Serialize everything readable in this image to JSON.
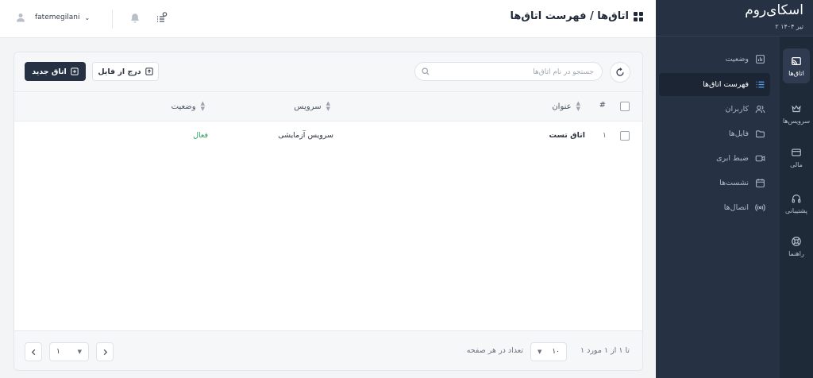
{
  "brand": {
    "name": "اسکای‌روم",
    "date": "۲ تیر ۱۴۰۴"
  },
  "rail": [
    {
      "label": "اتاق‌ها",
      "icon": "cast-icon",
      "active": true
    },
    {
      "label": "سرویس‌ها",
      "icon": "crown-icon"
    },
    {
      "label": "مالی",
      "icon": "credit-card-icon"
    },
    {
      "label": "پشتیبانی",
      "icon": "headphones-icon"
    },
    {
      "label": "راهنما",
      "icon": "lifebuoy-icon"
    }
  ],
  "menu": [
    {
      "label": "وضعیت",
      "icon": "chart-icon"
    },
    {
      "label": "فهرست اتاق‌ها",
      "icon": "list-icon",
      "active": true
    },
    {
      "label": "کاربران",
      "icon": "users-icon"
    },
    {
      "label": "فایل‌ها",
      "icon": "folder-icon"
    },
    {
      "label": "ضبط ابری",
      "icon": "video-icon"
    },
    {
      "label": "نشست‌ها",
      "icon": "calendar-icon"
    },
    {
      "label": "اتصال‌ها",
      "icon": "broadcast-icon"
    }
  ],
  "header": {
    "title": "اتاق‌ها / فهرست اتاق‌ها",
    "user": "fatemegilani"
  },
  "toolbar": {
    "new_room": "اتاق جدید",
    "import_file": "درج از فایل",
    "search_placeholder": "جستجو در نام اتاق‌ها"
  },
  "table": {
    "columns": {
      "index": "#",
      "title": "عنوان",
      "service": "سرویس",
      "status": "وضعیت"
    },
    "rows": [
      {
        "index": "۱",
        "title": "اتاق تست",
        "service": "سرویس آزمایشی",
        "status": "فعال"
      }
    ]
  },
  "footer": {
    "summary": "۱ تا ۱ از ۱ مورد",
    "per_page_label": "تعداد در هر صفحه",
    "per_page": "۱۰",
    "page": "۱"
  },
  "colors": {
    "sidebar": "#263244",
    "rail": "#1f2a38",
    "accent": "#5aa9ff",
    "active_status": "#2e9d5b"
  }
}
